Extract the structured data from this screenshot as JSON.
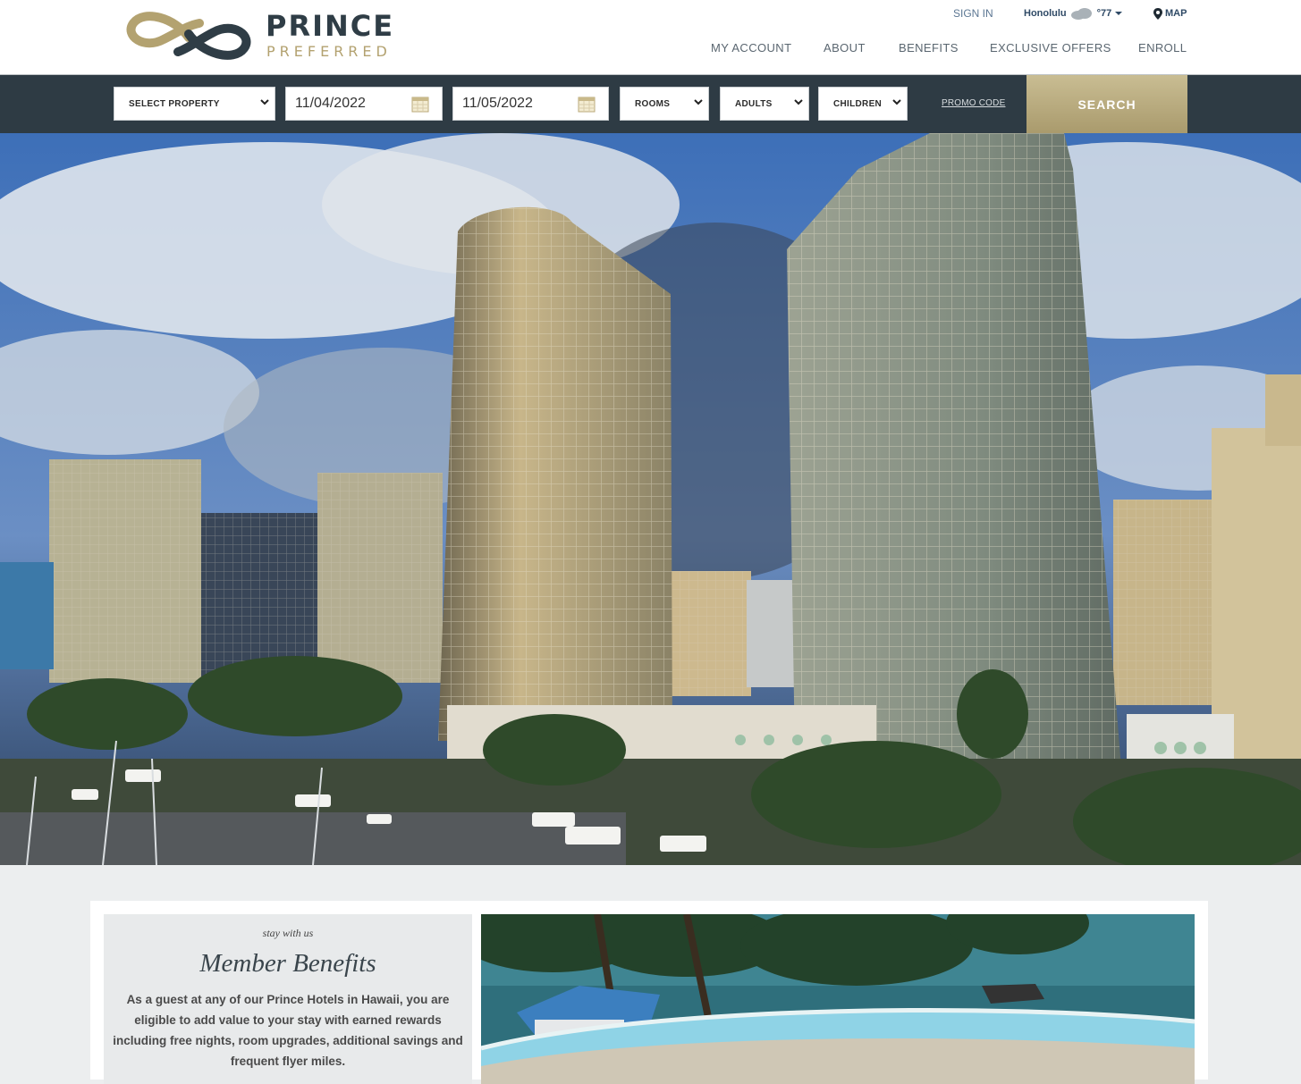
{
  "brand": {
    "line1": "PRINCE",
    "line2": "PREFERRED"
  },
  "utility": {
    "sign_in": "SIGN IN",
    "city": "Honolulu",
    "temperature": "°77",
    "map": "MAP"
  },
  "nav": {
    "my_account": "MY ACCOUNT",
    "about": "ABOUT",
    "benefits": "BENEFITS",
    "exclusive_offers": "EXCLUSIVE OFFERS",
    "enroll": "ENROLL"
  },
  "booking": {
    "property": "SELECT PROPERTY",
    "check_in": "11/04/2022",
    "check_out": "11/05/2022",
    "rooms": "ROOMS",
    "adults": "ADULTS",
    "children": "CHILDREN",
    "promo": "PROMO CODE",
    "search": "SEARCH"
  },
  "benefits": {
    "eyebrow": "stay with us",
    "title": "Member Benefits",
    "body": "As a guest at any of our Prince Hotels in Hawaii, you are eligible to add value to your stay with earned rewards including free nights, room upgrades, additional savings and frequent flyer miles."
  },
  "colors": {
    "navy": "#2e3b44",
    "gold": "#b3a270",
    "link": "#2f4a66"
  }
}
